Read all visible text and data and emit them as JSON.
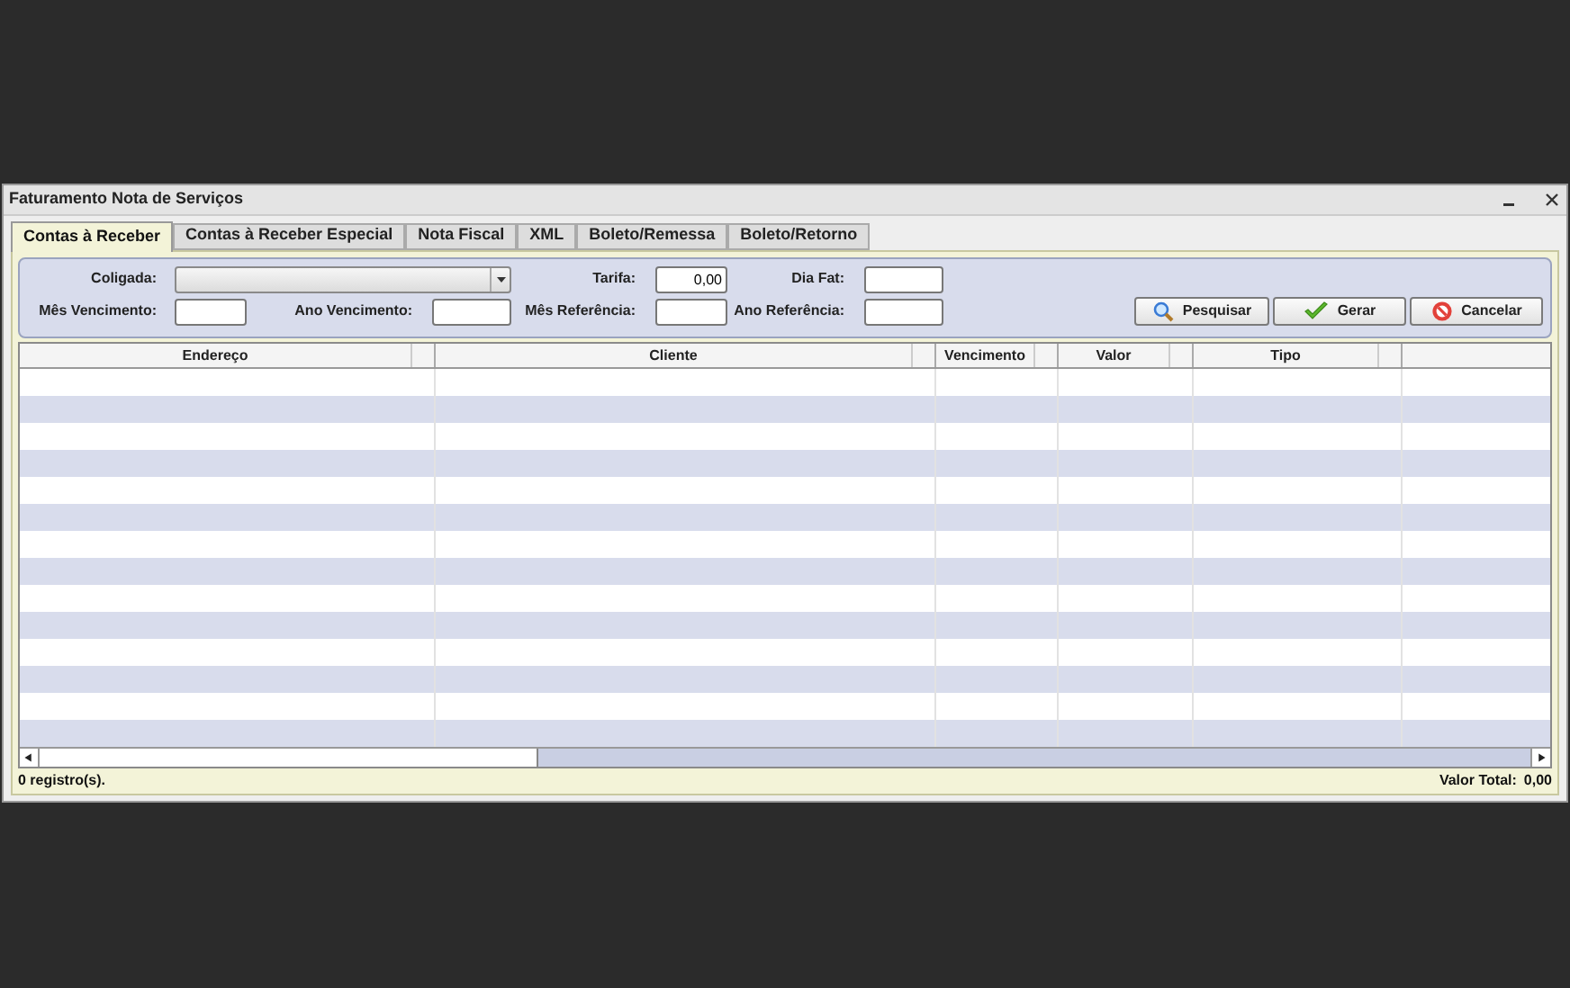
{
  "window": {
    "title": "Faturamento Nota de Serviços"
  },
  "tabs": [
    {
      "label": "Contas à Receber",
      "selected": true
    },
    {
      "label": "Contas à Receber Especial",
      "selected": false
    },
    {
      "label": "Nota Fiscal",
      "selected": false
    },
    {
      "label": "XML",
      "selected": false
    },
    {
      "label": "Boleto/Remessa",
      "selected": false
    },
    {
      "label": "Boleto/Retorno",
      "selected": false
    }
  ],
  "filters": [
    {
      "label": "Coligada:",
      "kind": "combo"
    },
    {
      "label": "Tarifa:",
      "kind": "text",
      "value": "0,00"
    },
    {
      "label": "Dia Fat:",
      "kind": "text"
    },
    {
      "label": "Mês Vencimento:",
      "kind": "text"
    },
    {
      "label": "Ano Vencimento:",
      "kind": "text"
    },
    {
      "label": "Mês Referência:",
      "kind": "text"
    },
    {
      "label": "Ano Referência:",
      "kind": "text"
    }
  ],
  "buttons": [
    {
      "label": "Pesquisar",
      "kind": "search"
    },
    {
      "label": "Gerar",
      "kind": "check"
    },
    {
      "label": "Cancelar",
      "kind": "cancel"
    }
  ],
  "table": {
    "columns": [
      "Endereço",
      "Cliente",
      "Vencimento",
      "Valor",
      "Tipo"
    ]
  },
  "status_bar": {
    "count": "0 registro(s).",
    "total_label": "Valor Total:",
    "total_value": "0,00"
  }
}
